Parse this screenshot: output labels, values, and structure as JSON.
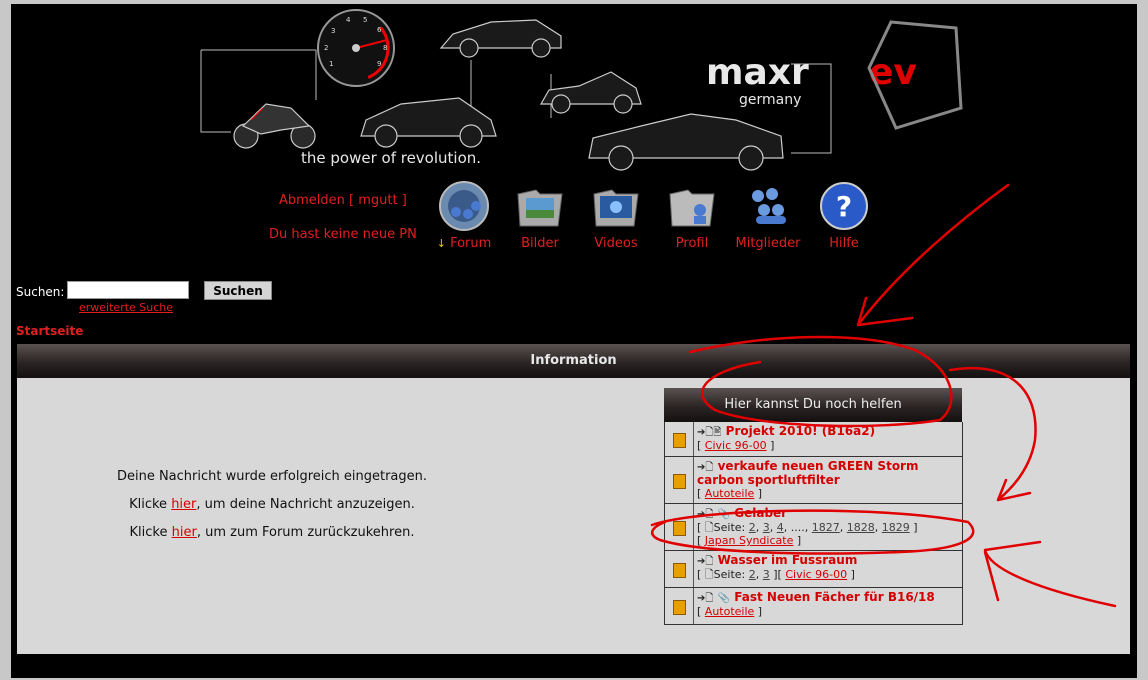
{
  "logo": {
    "brand_a": "maxr",
    "brand_b": "ev",
    "sub": "germany",
    "tagline": "the power of revolution."
  },
  "user": {
    "logout": "Abmelden [ mgutt ]",
    "pm": "Du hast keine neue PN"
  },
  "nav": [
    {
      "label": "Forum",
      "icon": "globe-users-icon",
      "active": true
    },
    {
      "label": "Bilder",
      "icon": "images-folder-icon"
    },
    {
      "label": "Videos",
      "icon": "videos-folder-icon"
    },
    {
      "label": "Profil",
      "icon": "profile-folder-icon"
    },
    {
      "label": "Mitglieder",
      "icon": "members-icon"
    },
    {
      "label": "Hilfe",
      "icon": "help-icon"
    }
  ],
  "search": {
    "label": "Suchen:",
    "value": "",
    "button": "Suchen",
    "advanced": "erweiterte Suche"
  },
  "breadcrumb": "Startseite",
  "panel": {
    "title": "Information",
    "line1": "Deine Nachricht wurde erfolgreich eingetragen.",
    "line2_pre": "Klicke ",
    "line2_link": "hier",
    "line2_post": ", um deine Nachricht anzuzeigen.",
    "line3_pre": "Klicke ",
    "line3_link": "hier",
    "line3_post": ", um zum Forum zurückzukehren."
  },
  "help": {
    "title": "Hier kannst Du noch helfen",
    "pages_label": "Seite:",
    "items": [
      {
        "title": "Projekt 2010! (B16a2)",
        "forum": "Civic 96-00"
      },
      {
        "title": "verkaufe neuen GREEN Storm carbon sportluftfilter",
        "forum": "Autoteile"
      },
      {
        "title": "Gelaber",
        "pages": [
          "2",
          "3",
          "4",
          "1827",
          "1828",
          "1829"
        ],
        "ellipsis": "....",
        "forum": "Japan Syndicate"
      },
      {
        "title": "Wasser im Fussraum",
        "pages": [
          "2",
          "3"
        ],
        "forum": "Civic 96-00"
      },
      {
        "title": "Fast Neuen Fächer für B16/18",
        "forum": "Autoteile"
      }
    ]
  },
  "colors": {
    "accent": "#e02020",
    "background": "#000000",
    "panel": "#d8d8d8",
    "annotation": "#e00000"
  }
}
